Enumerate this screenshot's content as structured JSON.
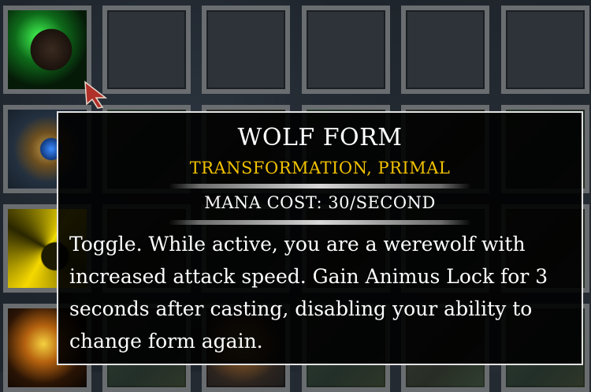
{
  "ability_grid": {
    "slots": [
      {
        "icon": "wolf-form-icon",
        "filled": true
      },
      {
        "icon": "empty-slot",
        "filled": false
      },
      {
        "icon": "empty-slot",
        "filled": false
      },
      {
        "icon": "empty-slot",
        "filled": false
      },
      {
        "icon": "empty-slot",
        "filled": false
      },
      {
        "icon": "empty-slot",
        "filled": false
      },
      {
        "icon": "shield-orb-icon",
        "filled": true
      },
      {
        "icon": "yellow-swirl-icon",
        "filled": true
      },
      {
        "icon": "fire-spirit-icon",
        "filled": true
      }
    ]
  },
  "tooltip": {
    "title": "WOLF FORM",
    "tags": "TRANSFORMATION, PRIMAL",
    "cost": "MANA COST: 30/SECOND",
    "description": "Toggle. While active, you are a werewolf with increased attack speed. Gain Animus Lock for 3 seconds after casting, disabling your ability to change form again."
  },
  "colors": {
    "tag_color": "#f2c200",
    "border_color": "#e2e2e2",
    "slot_frame": "#6a6d70"
  }
}
